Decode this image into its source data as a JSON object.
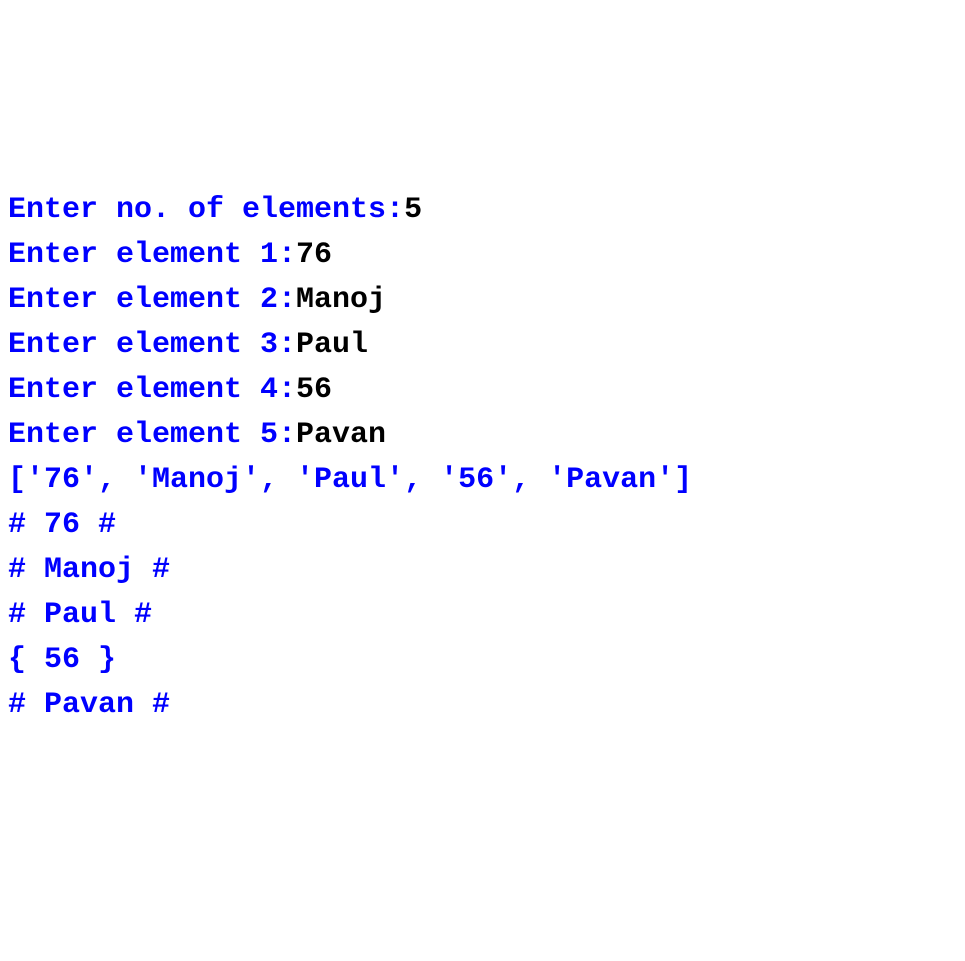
{
  "lines": [
    {
      "prompt": "Enter no. of elements:",
      "input": "5"
    },
    {
      "prompt": "Enter element 1:",
      "input": "76"
    },
    {
      "prompt": "Enter element 2:",
      "input": "Manoj"
    },
    {
      "prompt": "Enter element 3:",
      "input": "Paul"
    },
    {
      "prompt": "Enter element 4:",
      "input": "56"
    },
    {
      "prompt": "Enter element 5:",
      "input": "Pavan"
    }
  ],
  "output": [
    "['76', 'Manoj', 'Paul', '56', 'Pavan']",
    "# 76 #",
    "# Manoj #",
    "# Paul #",
    "{ 56 }",
    "# Pavan #"
  ]
}
